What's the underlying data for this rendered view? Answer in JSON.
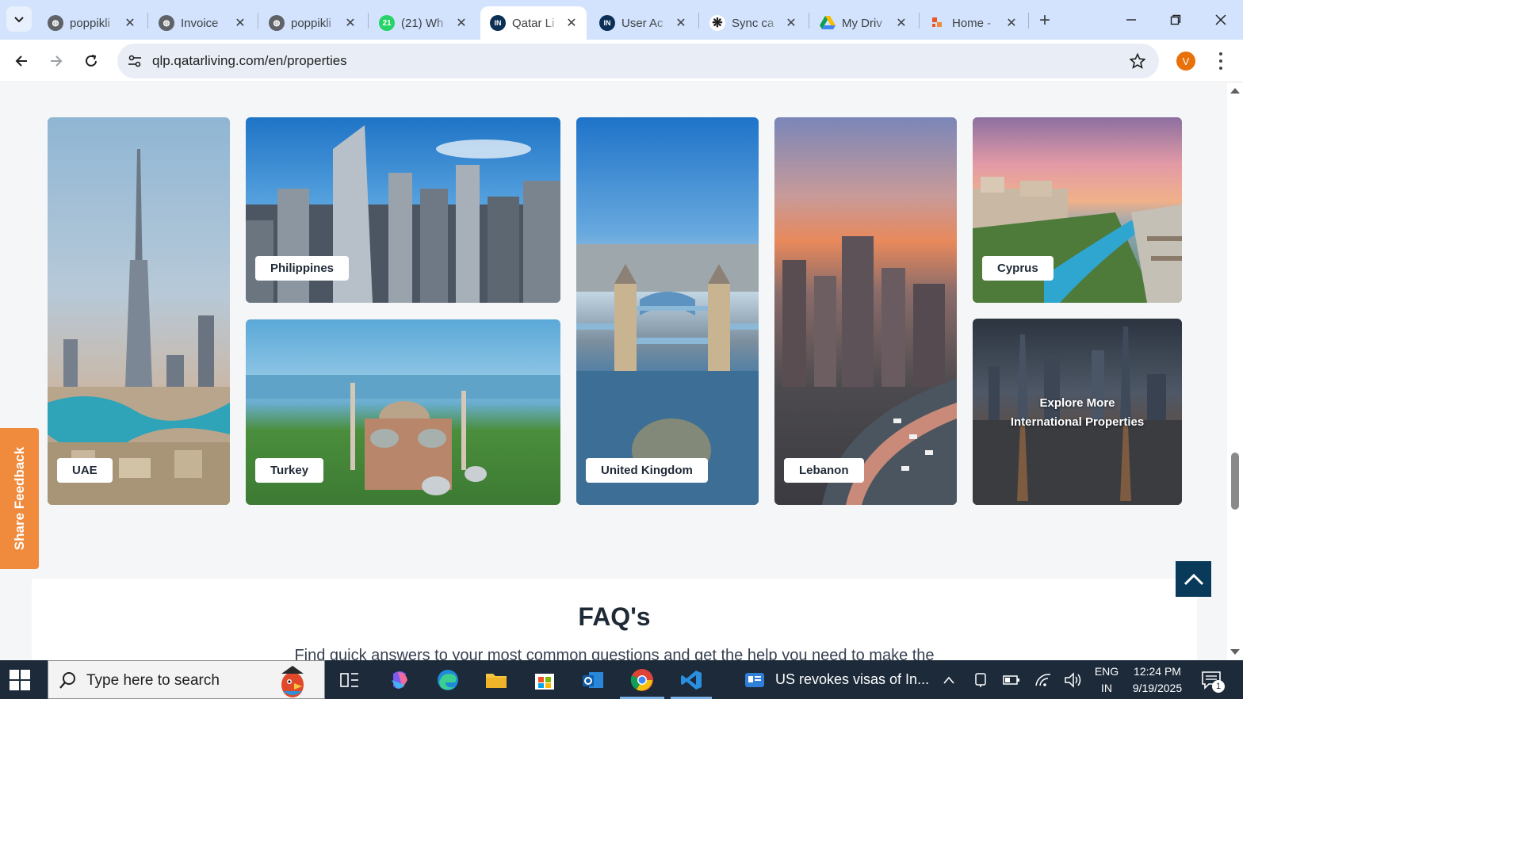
{
  "browser": {
    "tabs": [
      {
        "title": "poppikli",
        "favicon": "globe-icon"
      },
      {
        "title": "Invoice",
        "favicon": "globe-icon"
      },
      {
        "title": "poppikli",
        "favicon": "globe-icon"
      },
      {
        "title": "(21) Wh",
        "favicon": "whatsapp-icon",
        "badge": "21"
      },
      {
        "title": "Qatar Li",
        "favicon": "qatarliving-icon",
        "active": true
      },
      {
        "title": "User Ac",
        "favicon": "qatarliving-icon"
      },
      {
        "title": "Sync ca",
        "favicon": "openai-icon"
      },
      {
        "title": "My Driv",
        "favicon": "google-drive-icon"
      },
      {
        "title": "Home -",
        "favicon": "app-icon"
      }
    ],
    "url": "qlp.qatarliving.com/en/properties",
    "profile_initial": "V"
  },
  "page": {
    "countries": {
      "uae": "UAE",
      "philippines": "Philippines",
      "turkey": "Turkey",
      "united_kingdom": "United Kingdom",
      "lebanon": "Lebanon",
      "cyprus": "Cyprus"
    },
    "explore_more": {
      "line1": "Explore More",
      "line2": "International Properties"
    },
    "feedback_label": "Share Feedback",
    "faq": {
      "title": "FAQ's",
      "subtitle": "Find quick answers to your most common questions and get the help you need to make the"
    }
  },
  "taskbar": {
    "search_placeholder": "Type here to search",
    "news_headline": "US revokes visas of In...",
    "language": "ENG",
    "region": "IN",
    "time": "12:24 PM",
    "date": "9/19/2025",
    "notification_count": "1"
  },
  "colors": {
    "accent_orange": "#f08a3c",
    "back_to_top": "#0a3a5a",
    "tab_strip": "#d3e3fd"
  }
}
